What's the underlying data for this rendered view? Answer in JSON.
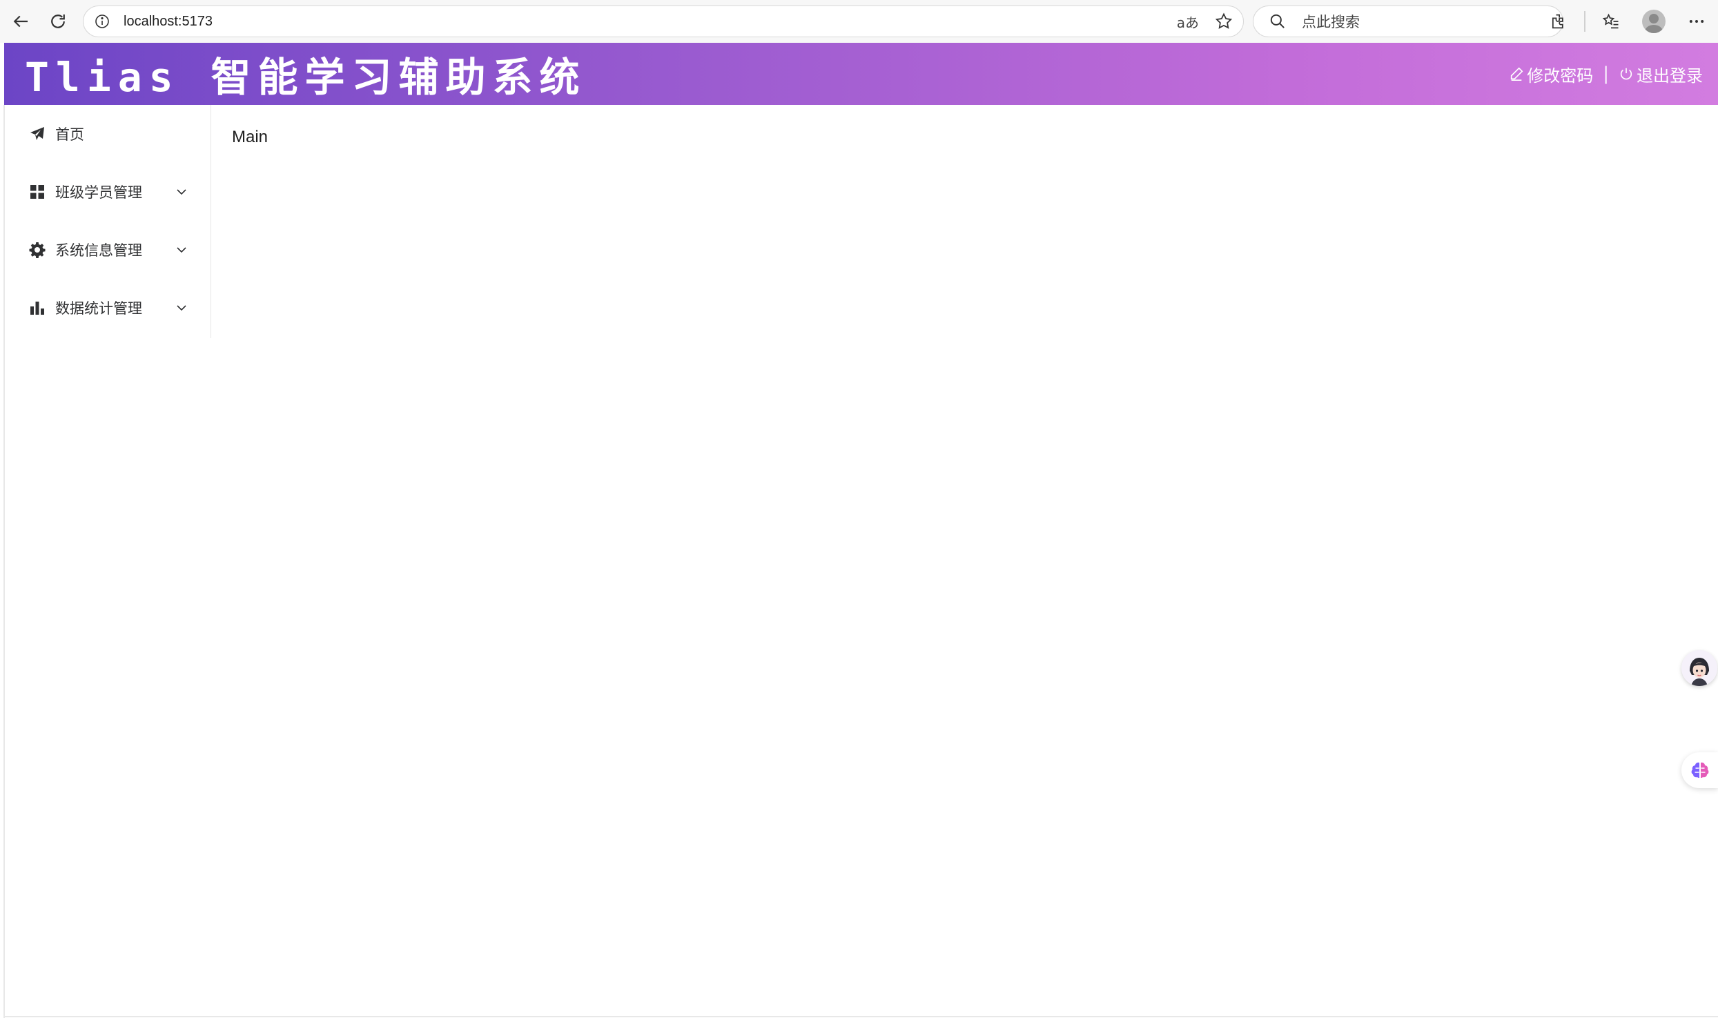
{
  "browser": {
    "url": "localhost:5173",
    "translate_label": "aあ",
    "search_placeholder": "点此搜索"
  },
  "header": {
    "title": "Tlias 智能学习辅助系统",
    "change_password": "修改密码",
    "separator": "|",
    "logout": "退出登录",
    "gradient_start": "#6c45c6",
    "gradient_end": "#d27ce0"
  },
  "sidebar": {
    "items": [
      {
        "label": "首页",
        "icon": "paper-plane-icon"
      },
      {
        "label": "班级学员管理",
        "icon": "grid-icon",
        "expandable": true
      },
      {
        "label": "系统信息管理",
        "icon": "gear-icon",
        "expandable": true
      },
      {
        "label": "数据统计管理",
        "icon": "bar-chart-icon",
        "expandable": true
      }
    ]
  },
  "main": {
    "text": "Main"
  }
}
